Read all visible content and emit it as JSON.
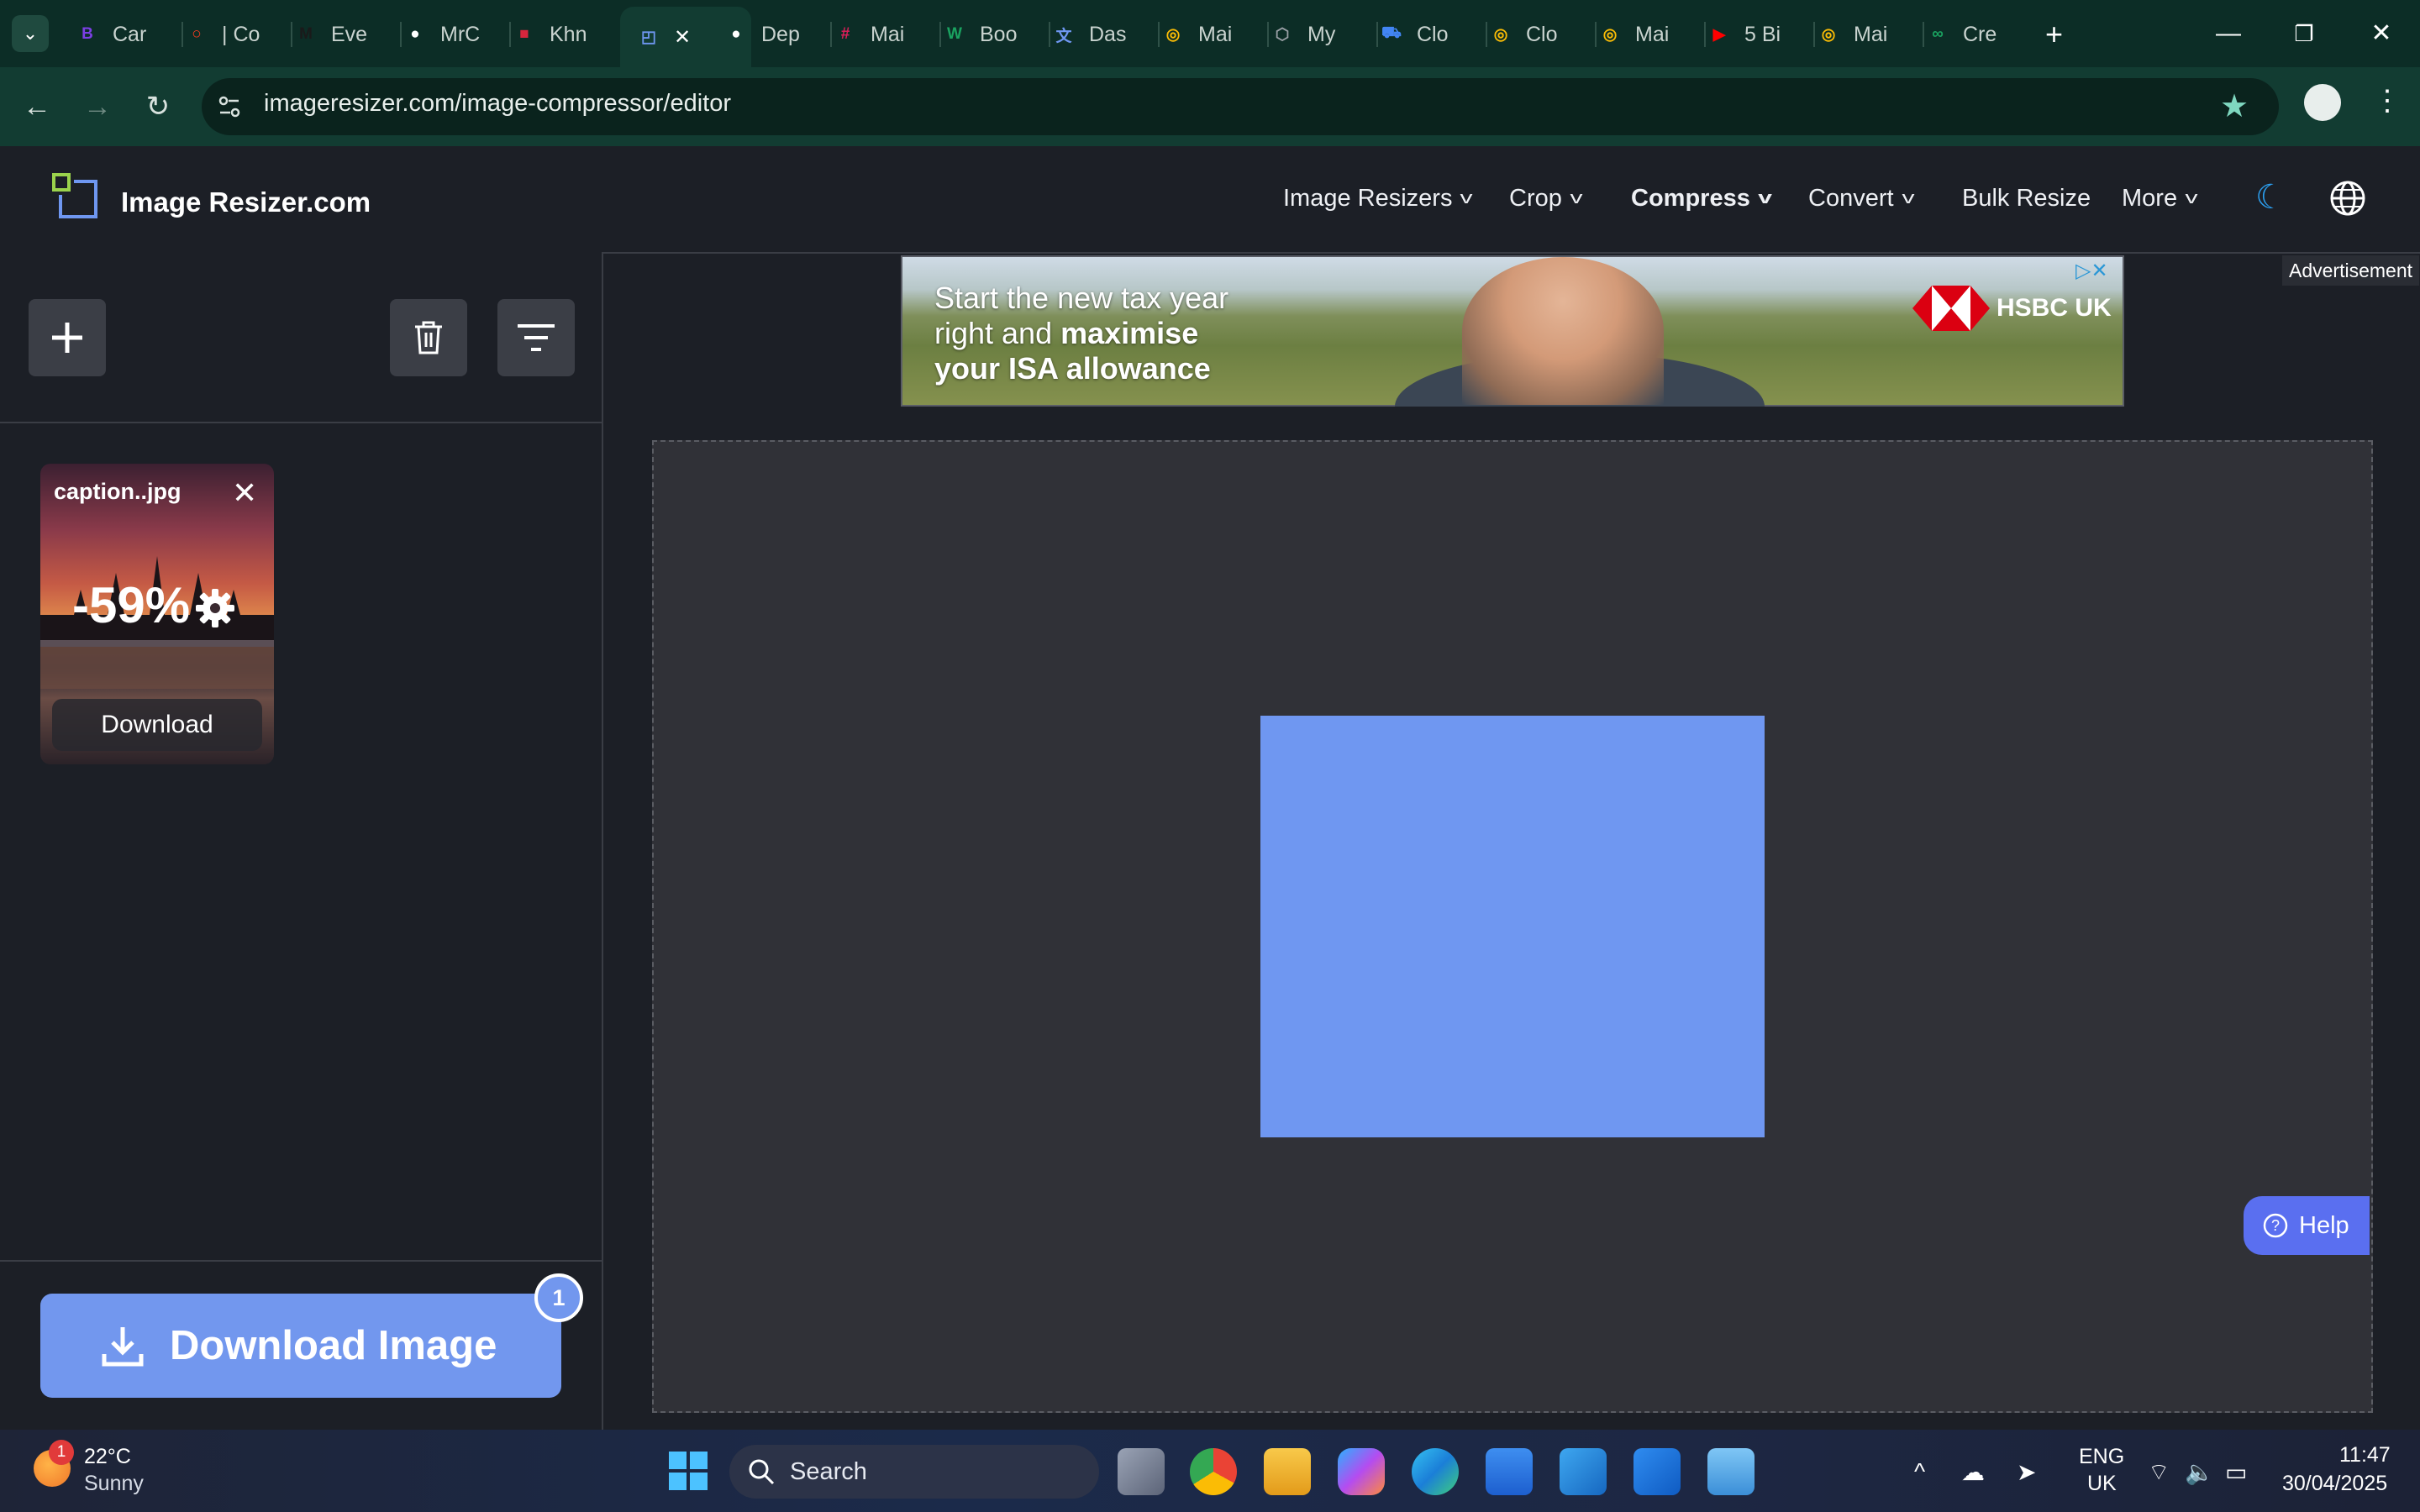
{
  "browser": {
    "tabs": [
      {
        "label": "Car",
        "icon": "b-circle-icon",
        "color": "#7b3fe4"
      },
      {
        "label": "| Co",
        "icon": "opera-ring-icon",
        "color": "#ff3b1f"
      },
      {
        "label": "Eve",
        "icon": "m-logo-icon",
        "color": "#1a1a1a"
      },
      {
        "label": "MrC",
        "icon": "github-icon",
        "color": "#ffffff"
      },
      {
        "label": "Khn",
        "icon": "flag-icon",
        "color": "#d7263d"
      },
      {
        "label": "",
        "icon": "image-resizer-icon",
        "color": "#6f97f1",
        "active": true
      },
      {
        "label": "Dep",
        "icon": "github-icon",
        "color": "#ffffff"
      },
      {
        "label": "Mai",
        "icon": "slack-icon",
        "color": "#e01e5a"
      },
      {
        "label": "Boo",
        "icon": "w-logo-icon",
        "color": "#1aa260"
      },
      {
        "label": "Das",
        "icon": "translate-icon",
        "color": "#6f97f1"
      },
      {
        "label": "Mai",
        "icon": "cloud-icon",
        "color": "#fbbc05"
      },
      {
        "label": "My",
        "icon": "hex-icon",
        "color": "#9aa0a6"
      },
      {
        "label": "Clo",
        "icon": "cart-icon",
        "color": "#4285f4"
      },
      {
        "label": "Clo",
        "icon": "cloud-icon",
        "color": "#fbbc05"
      },
      {
        "label": "Mai",
        "icon": "cloud-icon",
        "color": "#fbbc05"
      },
      {
        "label": "5 Bi",
        "icon": "youtube-icon",
        "color": "#ff0000"
      },
      {
        "label": "Mai",
        "icon": "cloud-icon",
        "color": "#fbbc05"
      },
      {
        "label": "Cre",
        "icon": "infinity-icon",
        "color": "#1aa260"
      }
    ],
    "url": "imageresizer.com/image-compressor/editor"
  },
  "site": {
    "logo_text": "Image Resizer.com",
    "nav": [
      {
        "label": "Image Resizers",
        "dropdown": true
      },
      {
        "label": "Crop",
        "dropdown": true
      },
      {
        "label": "Compress",
        "dropdown": true,
        "active": true
      },
      {
        "label": "Convert",
        "dropdown": true
      },
      {
        "label": "Bulk Resize",
        "dropdown": false
      },
      {
        "label": "More",
        "dropdown": true
      }
    ]
  },
  "file": {
    "name": "caption..jpg",
    "reduction": "-59%",
    "download_label": "Download"
  },
  "download_image": {
    "label": "Download Image",
    "count": "1"
  },
  "ad": {
    "line1": "Start the new tax year",
    "line2_plain": "right and ",
    "line2_bold": "maximise",
    "line3": "your ISA allowance",
    "brand": "HSBC UK",
    "tag": "Advertisement"
  },
  "help_label": "Help",
  "colors": {
    "accent": "#6f97f1",
    "download_button": "#7297ee",
    "help_button": "#5a6ff0",
    "page_bg": "#1c1f26",
    "workspace_bg": "#303137"
  },
  "taskbar": {
    "temperature": "22°C",
    "condition": "Sunny",
    "weather_badge": "1",
    "search_label": "Search",
    "lang_line1": "ENG",
    "lang_line2": "UK",
    "time": "11:47",
    "date": "30/04/2025"
  }
}
